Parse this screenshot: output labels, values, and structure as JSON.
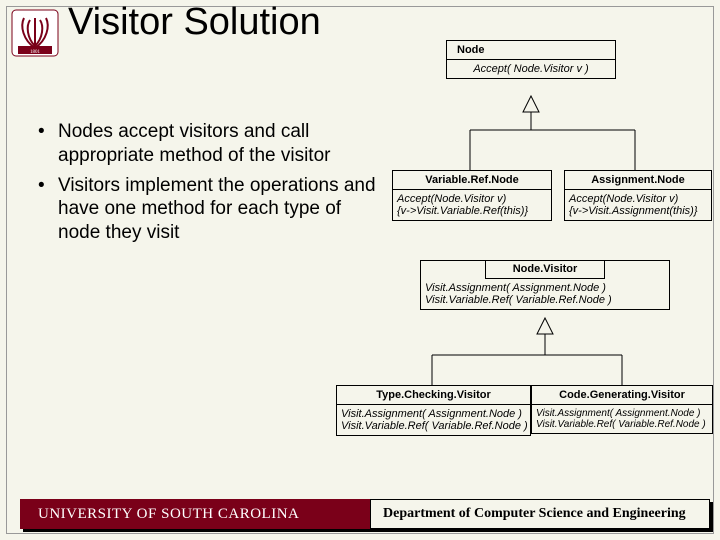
{
  "title": "Visitor Solution",
  "bullets": [
    "Nodes accept visitors and call appropriate method of the visitor",
    "Visitors implement the operations and have one method for each type of node they visit"
  ],
  "uml": {
    "node": {
      "name": "Node",
      "method": "Accept( Node.Visitor v )"
    },
    "variableRef": {
      "name": "Variable.Ref.Node",
      "m1": "Accept(Node.Visitor v)",
      "m2": "{v->Visit.Variable.Ref(this)}"
    },
    "assignment": {
      "name": "Assignment.Node",
      "m1": "Accept(Node.Visitor v)",
      "m2": "{v->Visit.Assignment(this)}"
    },
    "visitor": {
      "name": "Node.Visitor",
      "m1": "Visit.Assignment( Assignment.Node )",
      "m2": "Visit.Variable.Ref( Variable.Ref.Node )"
    },
    "typeChecking": {
      "name": "Type.Checking.Visitor",
      "m1": "Visit.Assignment( Assignment.Node )",
      "m2": "Visit.Variable.Ref( Variable.Ref.Node )"
    },
    "codeGen": {
      "name": "Code.Generating.Visitor",
      "m1": "Visit.Assignment( Assignment.Node )",
      "m2": "Visit.Variable.Ref( Variable.Ref.Node )"
    }
  },
  "footer": {
    "university": "UNIVERSITY OF SOUTH CAROLINA",
    "department": "Department of Computer Science and Engineering"
  }
}
